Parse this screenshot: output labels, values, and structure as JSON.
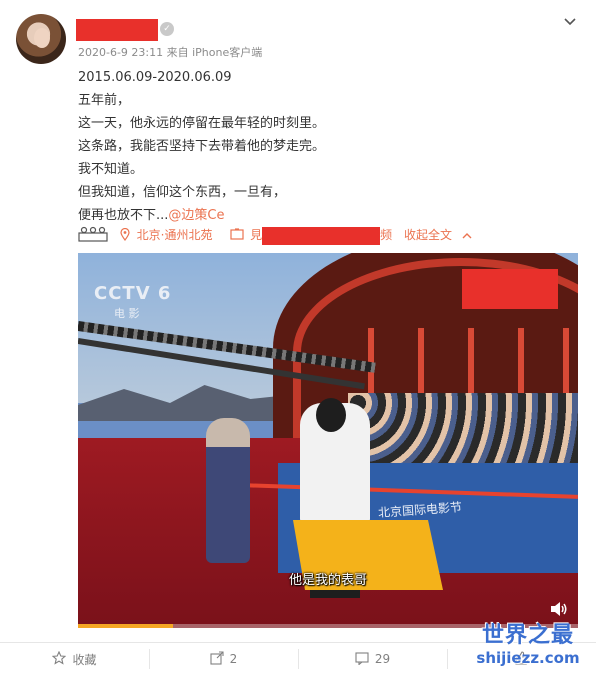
{
  "post": {
    "meta": "2020-6-9 23:11 来自 iPhone客户端",
    "lines": [
      "2015.06.09-2020.06.09",
      "五年前，",
      "这一天，他永远的停留在最年轻的时刻里。",
      "这条路，我能否坚持下去带着他的梦走完。",
      "我不知道。",
      "但我知道，信仰这个东西，一旦有，",
      "便再也放不下..."
    ],
    "mention": "@边策Ce",
    "info": {
      "location": "北京·通州北苑",
      "video_prefix": "見",
      "video_suffix": "频",
      "collapse": "收起全文"
    }
  },
  "video": {
    "channel_logo": "CCTV 6",
    "channel_sub": "电  影",
    "banner_text": "北京国际电影节",
    "subtitle": "他是我的表哥",
    "progress_fraction": 0.19
  },
  "actions": {
    "favorite": "收藏",
    "repost_count": "2",
    "comment_count": "29"
  },
  "watermark": {
    "line1": "世界之最",
    "line2": "shijiezz.com"
  },
  "colors": {
    "accent": "#eb7350",
    "redaction": "#e8302b",
    "watermark": "#3b6fd0"
  }
}
